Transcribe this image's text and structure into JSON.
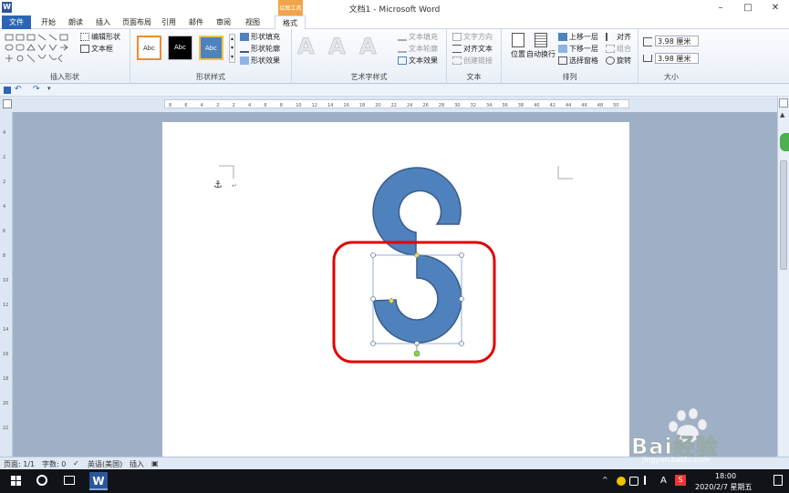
{
  "window": {
    "title": "文档1 - Microsoft Word",
    "tool_context_label": "绘图工具",
    "minimize_glyph": "–",
    "maximize_glyph": "□",
    "close_glyph": "✕",
    "word_icon_letter": "W"
  },
  "menu": {
    "file": "文件",
    "items": [
      "开始",
      "朗读",
      "插入",
      "页面布局",
      "引用",
      "邮件",
      "审阅",
      "视图",
      "格式"
    ]
  },
  "ribbon": {
    "insert_shapes": {
      "label": "插入形状",
      "edit_shape": "编辑形状",
      "text_box": "文本框"
    },
    "shape_styles": {
      "label": "形状样式",
      "style_samples": [
        "Abc",
        "Abc",
        "Abc"
      ],
      "fill": "形状填充",
      "outline": "形状轮廓",
      "effects": "形状效果"
    },
    "wordart": {
      "label": "艺术字样式",
      "letters": [
        "A",
        "A",
        "A"
      ],
      "text_fill": "文本填充",
      "text_outline": "文本轮廓",
      "text_effects": "文本效果"
    },
    "text": {
      "label": "文本",
      "text_direction": "文字方向",
      "align_text": "对齐文本",
      "create_link": "创建链接"
    },
    "arrange": {
      "label": "排列",
      "position": "位置",
      "wrap": "自动换行",
      "bring_forward": "上移一层",
      "send_backward": "下移一层",
      "selection_pane": "选择窗格",
      "align": "对齐",
      "group": "组合",
      "rotate": "旋转"
    },
    "size": {
      "label": "大小",
      "height": "3.98 厘米",
      "width": "3.98 厘米"
    }
  },
  "ruler_marks": [
    "8",
    "6",
    "4",
    "2",
    "2",
    "4",
    "6",
    "8",
    "10",
    "12",
    "14",
    "16",
    "18",
    "20",
    "22",
    "24",
    "26",
    "28",
    "30",
    "32",
    "34",
    "36",
    "38",
    "40",
    "42",
    "44",
    "46",
    "48",
    "50"
  ],
  "vruler_marks": [
    "4",
    "2",
    "2",
    "4",
    "6",
    "8",
    "10",
    "12",
    "14",
    "16",
    "18",
    "20",
    "22"
  ],
  "status": {
    "page": "页面: 1/1",
    "words": "字数: 0",
    "language": "英语(美国)",
    "mode": "插入"
  },
  "taskbar": {
    "time": "18:00",
    "date": "2020/2/7 星期五",
    "ime": "A",
    "chevron": "^"
  },
  "watermark": {
    "brand": "Bai经验",
    "url": "jingyan.baidu.com"
  },
  "colors": {
    "shape_fill": "#4f81bd",
    "shape_stroke": "#385d8a",
    "highlight_red": "#e00000",
    "file_tab": "#2b65b5",
    "tool_tab": "#f2a44a"
  }
}
